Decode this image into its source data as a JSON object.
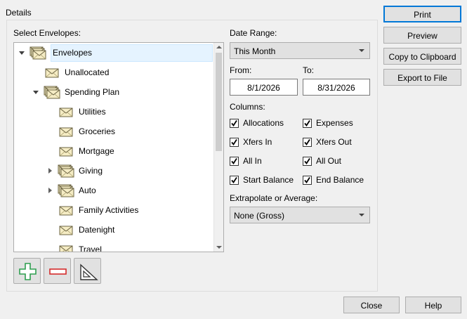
{
  "details": {
    "group_title": "Details",
    "select_envelopes_label": "Select Envelopes:"
  },
  "tree": {
    "items": [
      {
        "label": "Envelopes",
        "level": 0,
        "expander": "expanded",
        "icon": "envelope-stack-icon",
        "selected": true
      },
      {
        "label": "Unallocated",
        "level": 1,
        "expander": "none",
        "icon": "envelope-icon"
      },
      {
        "label": "Spending Plan",
        "level": 1,
        "expander": "expanded",
        "icon": "envelope-stack-icon"
      },
      {
        "label": "Utilities",
        "level": 2,
        "expander": "none",
        "icon": "envelope-icon"
      },
      {
        "label": "Groceries",
        "level": 2,
        "expander": "none",
        "icon": "envelope-icon"
      },
      {
        "label": "Mortgage",
        "level": 2,
        "expander": "none",
        "icon": "envelope-icon"
      },
      {
        "label": "Giving",
        "level": 2,
        "expander": "collapsed",
        "icon": "envelope-stack-icon"
      },
      {
        "label": "Auto",
        "level": 2,
        "expander": "collapsed",
        "icon": "envelope-stack-icon"
      },
      {
        "label": "Family Activities",
        "level": 2,
        "expander": "none",
        "icon": "envelope-icon"
      },
      {
        "label": "Datenight",
        "level": 2,
        "expander": "none",
        "icon": "envelope-icon"
      },
      {
        "label": "Travel",
        "level": 2,
        "expander": "none",
        "icon": "envelope-icon"
      }
    ]
  },
  "tools": {
    "add_icon": "plus-icon",
    "remove_icon": "minus-icon",
    "edit_icon": "set-square-icon"
  },
  "date_range": {
    "label": "Date Range:",
    "value": "This Month",
    "from_label": "From:",
    "to_label": "To:",
    "from_value": "8/1/2026",
    "to_value": "8/31/2026"
  },
  "columns": {
    "label": "Columns:",
    "items": [
      {
        "label": "Allocations",
        "checked": true
      },
      {
        "label": "Expenses",
        "checked": true
      },
      {
        "label": "Xfers In",
        "checked": true
      },
      {
        "label": "Xfers Out",
        "checked": true
      },
      {
        "label": "All In",
        "checked": true
      },
      {
        "label": "All Out",
        "checked": true
      },
      {
        "label": "Start Balance",
        "checked": true
      },
      {
        "label": "End Balance",
        "checked": true
      }
    ]
  },
  "extrapolate": {
    "label": "Extrapolate or Average:",
    "value": "None (Gross)"
  },
  "actions": {
    "print": "Print",
    "preview": "Preview",
    "copy": "Copy to Clipboard",
    "export": "Export to File",
    "close": "Close",
    "help": "Help"
  },
  "colors": {
    "accent": "#0078d7",
    "add_green": "#2e9e4f",
    "remove_red": "#d42b2b"
  }
}
